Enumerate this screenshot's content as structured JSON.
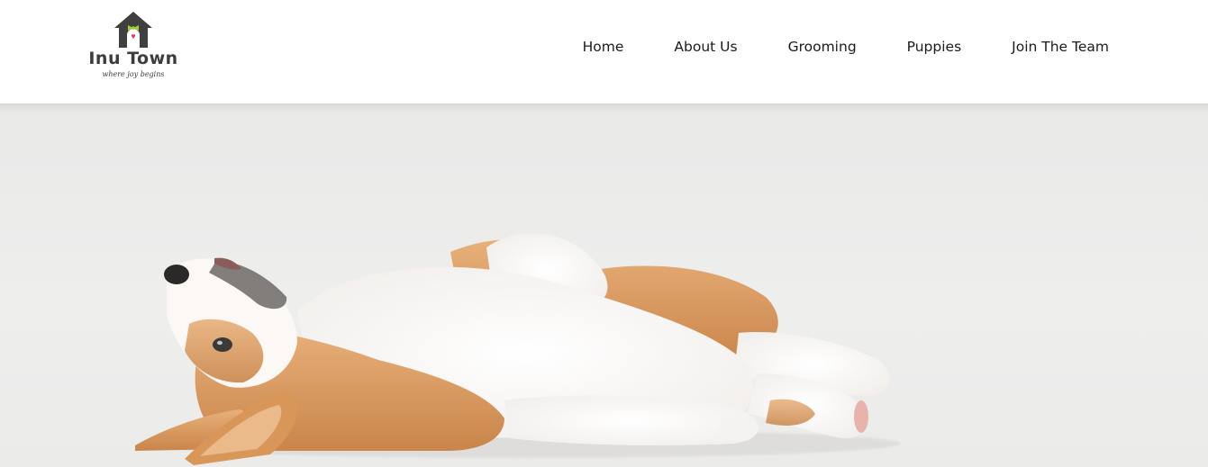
{
  "brand": {
    "name": "Inu Town",
    "tagline": "where joy begins",
    "colors": {
      "roof": "#3f3f3f",
      "bow": "#9bd12c",
      "heart": "#e0336b"
    }
  },
  "nav": {
    "items": [
      {
        "label": "Home"
      },
      {
        "label": "About Us"
      },
      {
        "label": "Grooming"
      },
      {
        "label": "Puppies"
      },
      {
        "label": "Join The Team"
      }
    ]
  },
  "hero": {
    "image": "corgi-puppy-lying-on-back",
    "background": "#ececeb"
  }
}
